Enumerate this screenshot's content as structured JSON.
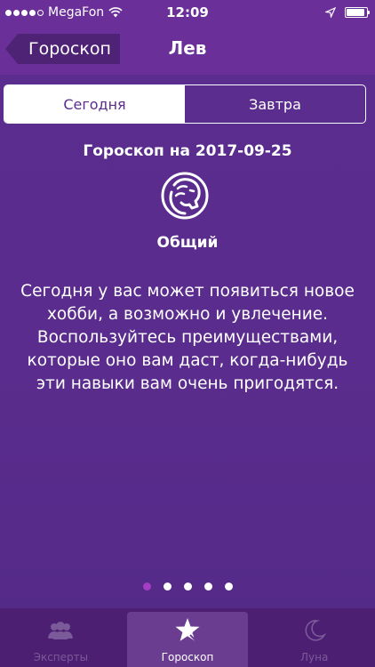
{
  "status_bar": {
    "carrier": "MegaFon",
    "time": "12:09",
    "signal_dots_filled": 4,
    "signal_dots_total": 5,
    "battery_level": 0.9
  },
  "nav": {
    "back_label": "Гороскоп",
    "title": "Лев"
  },
  "segments": {
    "today": "Сегодня",
    "tomorrow": "Завтра"
  },
  "content": {
    "date_heading": "Гороскоп на 2017-09-25",
    "sign_icon": "leo-icon",
    "category": "Общий",
    "text": "Сегодня у вас может появиться новое хобби, а возможно и увлечение. Воспользуйтесь преимуществами, которые оно вам даст, когда-нибудь эти навыки вам очень пригодятся."
  },
  "pager": {
    "current": 1,
    "total": 5
  },
  "tabs": [
    {
      "label": "Эксперты",
      "icon": "people-icon"
    },
    {
      "label": "Гороскоп",
      "icon": "star-icon"
    },
    {
      "label": "Луна",
      "icon": "moon-icon"
    }
  ],
  "colors": {
    "background": "#5b2d8e",
    "nav_bar": "#6a2f98",
    "tab_bar": "#4c1f72",
    "accent_dot": "#a53ec4"
  }
}
